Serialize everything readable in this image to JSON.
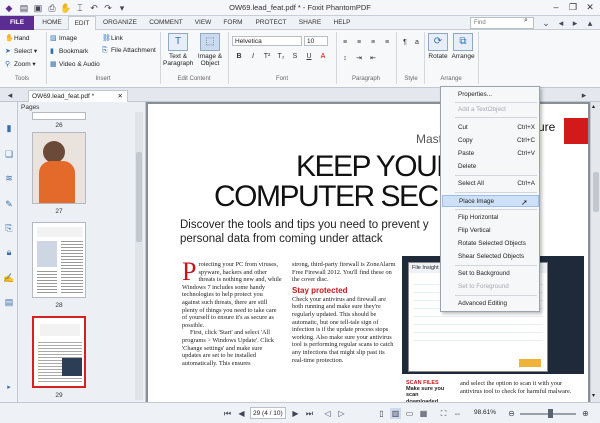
{
  "window": {
    "title": "OW69.lead_feat.pdf * - Foxit PhantomPDF"
  },
  "menu": {
    "tabs": [
      "FILE",
      "HOME",
      "EDIT",
      "ORGANIZE",
      "COMMENT",
      "VIEW",
      "FORM",
      "PROTECT",
      "SHARE",
      "HELP"
    ],
    "active": "EDIT",
    "find_placeholder": "Find"
  },
  "ribbon": {
    "tools": {
      "hand": "Hand",
      "select": "Select",
      "zoom": "Zoom",
      "label": "Tools"
    },
    "insert": {
      "image": "Image",
      "bookmark": "Bookmark",
      "video_audio": "Video & Audio",
      "link": "Link",
      "file_attachment": "File Attachment",
      "label": "Insert"
    },
    "edit_content": {
      "text_paragraph": "Text & Paragraph",
      "image_object": "Image & Object",
      "label": "Edit Content"
    },
    "font": {
      "name": "Helvetica",
      "size": "10",
      "label": "Font"
    },
    "paragraph": {
      "label": "Paragraph"
    },
    "style": {
      "label": "Style"
    },
    "arrange": {
      "rotate": "Rotate",
      "arrange": "Arrange",
      "label": "Arrange"
    }
  },
  "document": {
    "tab_label": "OW69.lead_feat.pdf *"
  },
  "pages_panel": {
    "title": "Pages",
    "page_numbers": [
      "26",
      "27",
      "28",
      "29"
    ]
  },
  "page_content": {
    "header_partial_left": "Maste",
    "header_partial_right": "ure",
    "headline_1": "KEEP YOUR",
    "headline_2": "COMPUTER SEC",
    "standfirst_1": "Discover the tools and tips you need to prevent y",
    "standfirst_2": "personal data from coming under attack",
    "col1": "rotecting your PC from viruses, spyware, hackers and other threats is nothing new and, while Windows 7 includes some handy technologies to help protect you against such threats, there are still plenty of things you need to take care of yourself to ensure it's as secure as possible.",
    "col1b": "First, click 'Start' and select 'All programs > Windows Update'. Click 'Change settings' and make sure updates are set to be installed automatically. This ensures",
    "col2a": "strong, third-party firewall is ZoneAlarm Free Firewall 2012. You'll find these on the cover disc.",
    "col2_head": "Stay protected",
    "col2b": "Check your antivirus and firewall are both running and make sure they're regularly updated. This should be automatic, but one tell-tale sign of infection is if the update process stops working. Also make sure your antivirus tool is performing regular scans to catch any infections that might slip past its real-time protection.",
    "caption_title": "SCAN FILES",
    "caption_body": "Make sure you scan downloaded files before",
    "col4": "and select the option to scan it with your antivirus tool to check for harmful malware.",
    "screenshot_title": "File Insight"
  },
  "context_menu": {
    "items": [
      {
        "label": "Properties...",
        "shortcut": "",
        "disabled": false
      },
      {
        "label": "Add a TextObject",
        "shortcut": "",
        "disabled": true
      },
      {
        "label": "Cut",
        "shortcut": "Ctrl+X",
        "disabled": false
      },
      {
        "label": "Copy",
        "shortcut": "Ctrl+C",
        "disabled": false
      },
      {
        "label": "Paste",
        "shortcut": "Ctrl+V",
        "disabled": false
      },
      {
        "label": "Delete",
        "shortcut": "",
        "disabled": false
      },
      {
        "label": "Select All",
        "shortcut": "Ctrl+A",
        "disabled": false
      },
      {
        "label": "Place Image",
        "shortcut": "",
        "disabled": false
      },
      {
        "label": "Flip Horizontal",
        "shortcut": "",
        "disabled": false
      },
      {
        "label": "Flip Vertical",
        "shortcut": "",
        "disabled": false
      },
      {
        "label": "Rotate Selected Objects",
        "shortcut": "",
        "disabled": false
      },
      {
        "label": "Shear Selected Objects",
        "shortcut": "",
        "disabled": false
      },
      {
        "label": "Set to Background",
        "shortcut": "",
        "disabled": false
      },
      {
        "label": "Set to Foreground",
        "shortcut": "",
        "disabled": true
      },
      {
        "label": "Advanced Editing",
        "shortcut": "",
        "disabled": false
      }
    ],
    "highlighted": "Place Image"
  },
  "statusbar": {
    "page_field": "29 (4 / 10)",
    "zoom": "98.61%"
  },
  "colors": {
    "file_tab": "#5b2c91",
    "accent_red": "#d31a1a",
    "highlight": "#cde0f7"
  }
}
